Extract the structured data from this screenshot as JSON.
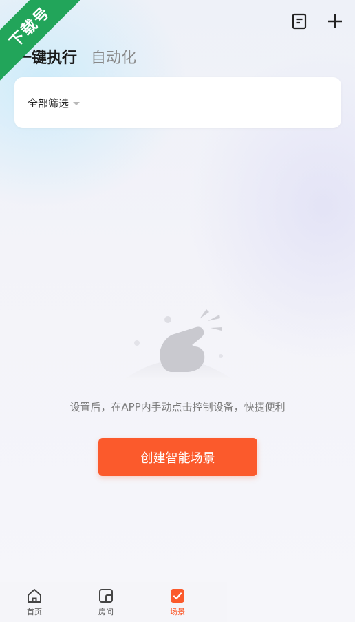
{
  "watermark": "下载号",
  "header": {
    "tabs": [
      {
        "label": "一键执行",
        "active": true
      },
      {
        "label": "自动化",
        "active": false
      }
    ],
    "icons": [
      "list-icon",
      "plus-icon"
    ]
  },
  "filter": {
    "label": "全部筛选"
  },
  "empty_state": {
    "message": "设置后，在APP内手动点击控制设备，快捷便利",
    "button_label": "创建智能场景"
  },
  "bottom_nav": [
    {
      "label": "首页",
      "icon": "home-icon",
      "active": false
    },
    {
      "label": "房间",
      "icon": "room-icon",
      "active": false
    },
    {
      "label": "场景",
      "icon": "scene-icon",
      "active": true
    }
  ],
  "colors": {
    "accent": "#fb5a2c",
    "watermark_bg": "#22a55a"
  }
}
